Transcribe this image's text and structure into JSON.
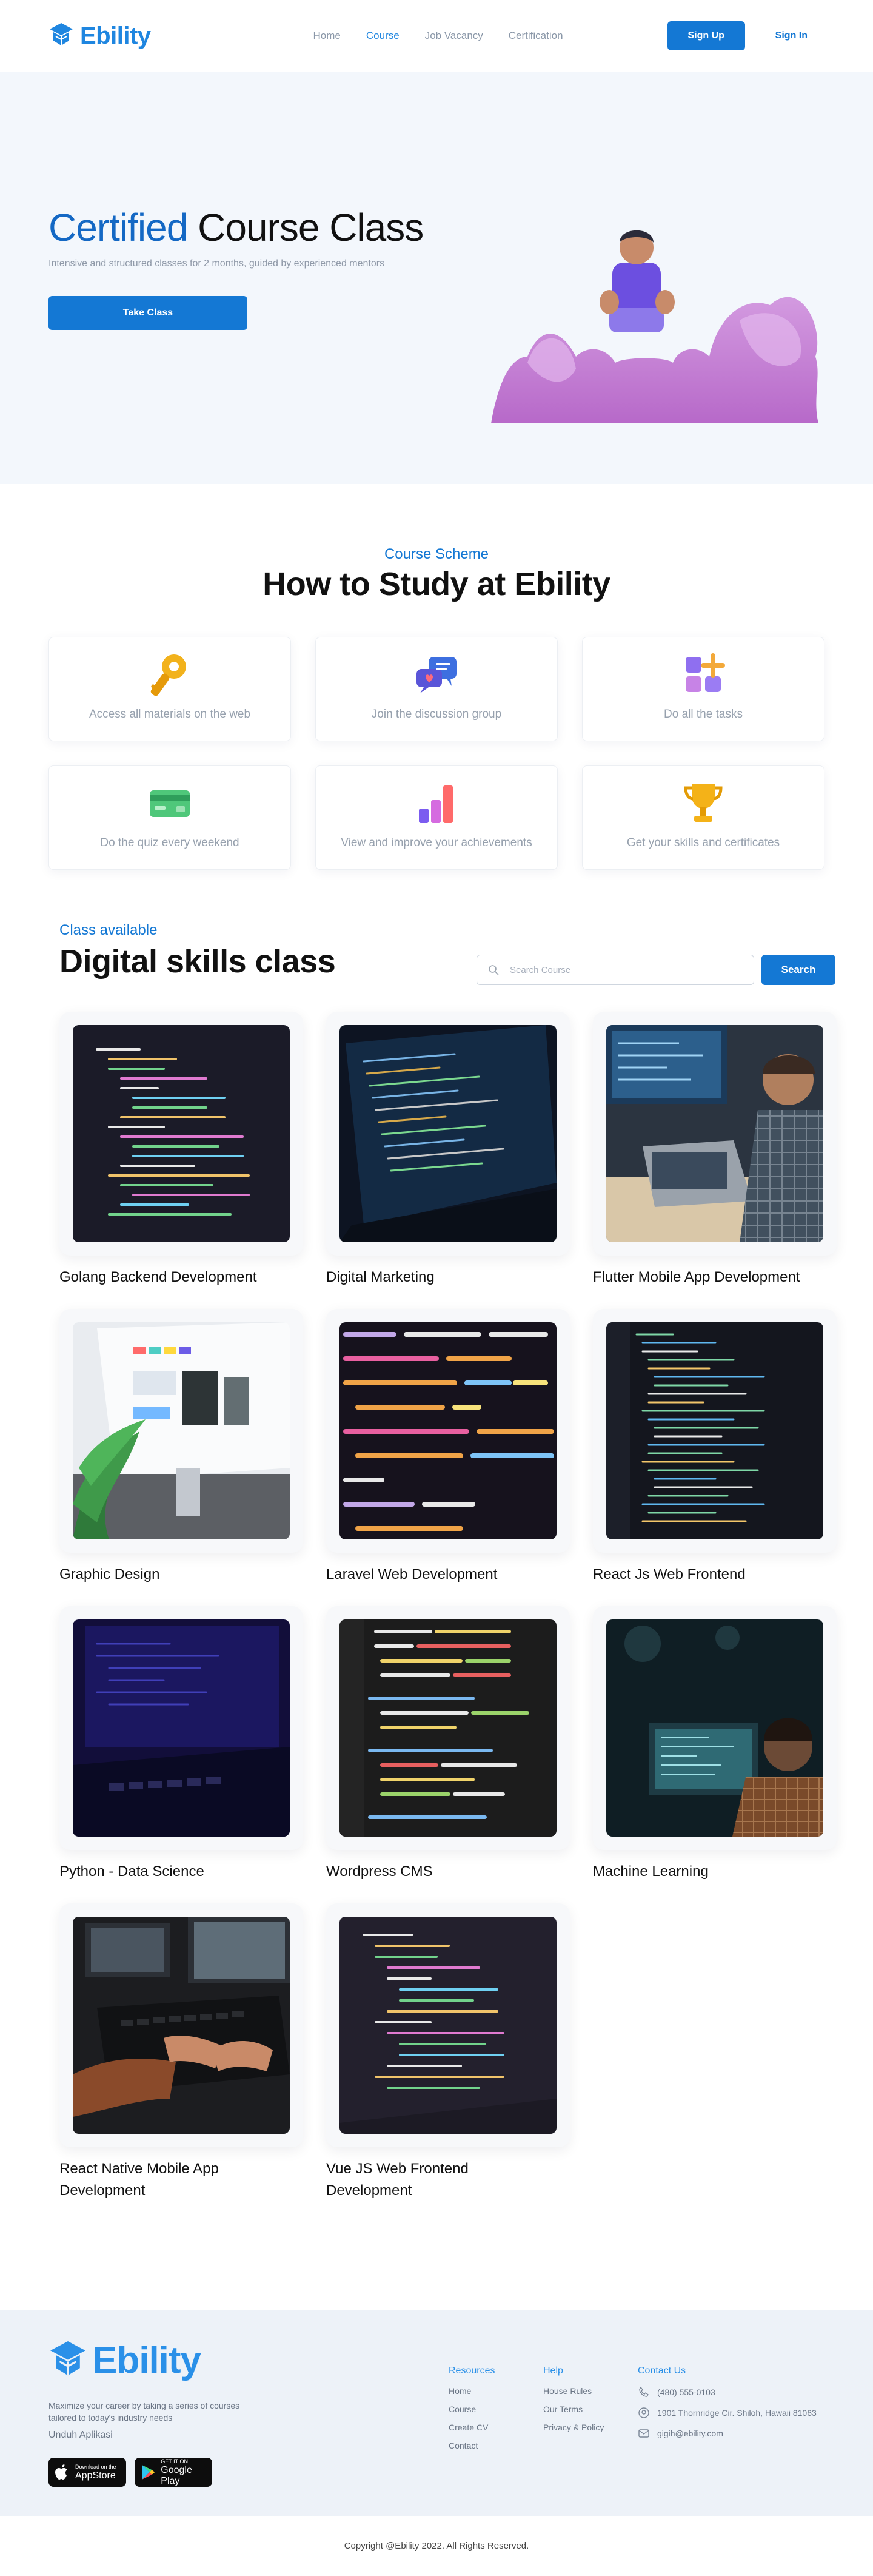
{
  "brand": {
    "name": "Ebility",
    "color": "#1f86e0"
  },
  "nav": {
    "items": [
      {
        "label": "Home",
        "active": false
      },
      {
        "label": "Course",
        "active": true
      },
      {
        "label": "Job Vacancy",
        "active": false
      },
      {
        "label": "Certification",
        "active": false
      }
    ],
    "signup_label": "Sign Up",
    "signin_label": "Sign In"
  },
  "hero": {
    "title_accent": "Certified",
    "title_rest": " Course Class",
    "subtitle": "Intensive and structured classes for 2 months, guided by experienced mentors",
    "cta_label": "Take Class"
  },
  "scheme": {
    "kicker": "Course Scheme",
    "title": "How to Study at Ebility",
    "cards": [
      {
        "icon": "key-icon",
        "label": "Access all materials on the web"
      },
      {
        "icon": "chat-bubbles-icon",
        "label": "Join the discussion group"
      },
      {
        "icon": "tasks-blocks-icon",
        "label": "Do all the tasks"
      },
      {
        "icon": "credit-card-icon",
        "label": "Do the quiz every weekend"
      },
      {
        "icon": "bar-chart-icon",
        "label": "View and improve your achievements"
      },
      {
        "icon": "trophy-icon",
        "label": "Get your skills and certificates"
      }
    ]
  },
  "classes": {
    "kicker": "Class available",
    "title": "Digital skills class",
    "search_placeholder": "Search Course",
    "search_label": "Search",
    "courses": [
      {
        "name": "Golang Backend Development"
      },
      {
        "name": "Digital Marketing"
      },
      {
        "name": "Flutter Mobile App Development"
      },
      {
        "name": "Graphic Design"
      },
      {
        "name": "Laravel Web Development"
      },
      {
        "name": "React Js Web Frontend"
      },
      {
        "name": "Python - Data Science"
      },
      {
        "name": "Wordpress CMS"
      },
      {
        "name": "Machine Learning"
      },
      {
        "name": "React Native Mobile App Development"
      },
      {
        "name": "Vue JS Web Frontend Development"
      }
    ]
  },
  "footer": {
    "brand": "Ebility",
    "description": "Maximize your career by taking a series of courses tailored to today's industry needs",
    "download_label": "Unduh Aplikasi",
    "appstore_small": "Download on the",
    "appstore_big": "AppStore",
    "googleplay_small": "GET IT ON",
    "googleplay_big": "Google Play",
    "resources": {
      "title": "Resources",
      "links": [
        "Home",
        "Course",
        "Create CV",
        "Contact"
      ]
    },
    "help": {
      "title": "Help",
      "links": [
        "House Rules",
        "Our Terms",
        "Privacy & Policy"
      ]
    },
    "contact": {
      "title": "Contact Us",
      "phone": "(480) 555-0103",
      "address": "1901 Thornridge Cir. Shiloh, Hawaii 81063",
      "email": "gigih@ebility.com"
    },
    "copyright": "Copyright @Ebility 2022. All Rights Reserved."
  }
}
